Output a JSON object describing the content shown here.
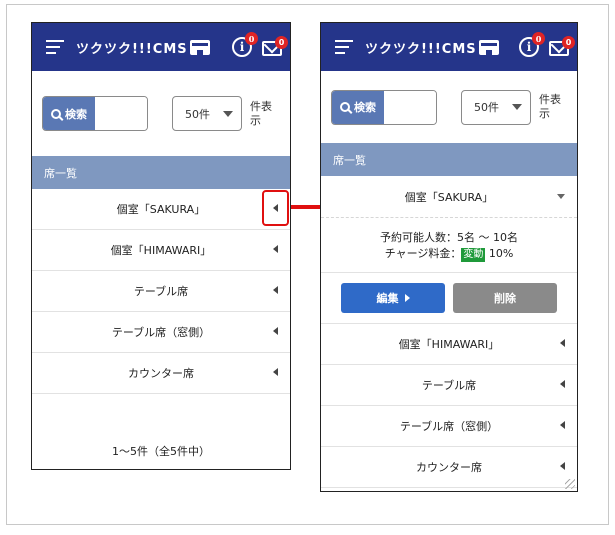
{
  "header": {
    "logo_text": "ツクツク!!!CMS",
    "info_badge": "0",
    "mail_badge": "0",
    "info_glyph": "i"
  },
  "search": {
    "button_label": "検索",
    "field_value": "",
    "per_page_value": "50件",
    "per_page_suffix": "件表示"
  },
  "section": {
    "title": "席一覧"
  },
  "seats": [
    {
      "name": "個室「SAKURA」"
    },
    {
      "name": "個室「HIMAWARI」"
    },
    {
      "name": "テーブル席"
    },
    {
      "name": "テーブル席（窓側）"
    },
    {
      "name": "カウンター席"
    }
  ],
  "pager": {
    "summary": "1〜5件（全5件中）"
  },
  "expanded": {
    "capacity_label": "予約可能人数：5名 〜 10名",
    "charge_label": "チャージ料金：",
    "charge_tag": "変動",
    "charge_value": "10%",
    "edit_label": "編集",
    "delete_label": "削除"
  },
  "colors": {
    "header_bg": "#25358a",
    "section_bg": "#7f98c0",
    "edit_button": "#2f6ac8",
    "delete_button": "#8a8a8a",
    "highlight": "#e01010",
    "tag_green": "#1f9a3a"
  }
}
